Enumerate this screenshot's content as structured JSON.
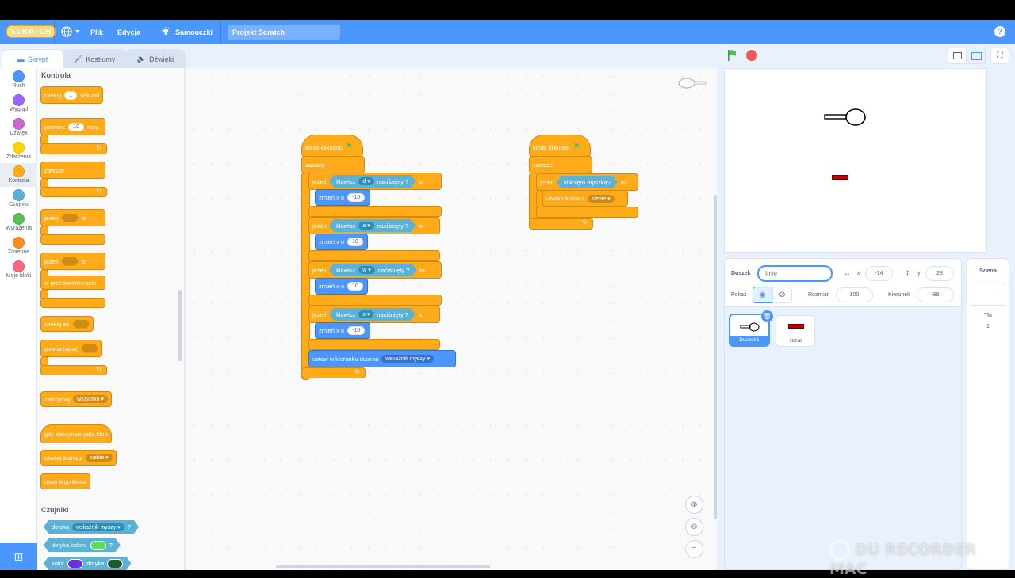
{
  "menu": {
    "logo": "SCRATCH",
    "file": "Plik",
    "edit": "Edycja",
    "tutorials": "Samouczki",
    "project_name": "Projekt Scratch",
    "help": "?"
  },
  "tabs": [
    {
      "label": "Skrypt",
      "active": true
    },
    {
      "label": "Kostiumy",
      "active": false
    },
    {
      "label": "Dźwięki",
      "active": false
    }
  ],
  "categories": [
    {
      "label": "Ruch",
      "color": "#4c97ff"
    },
    {
      "label": "Wygląd",
      "color": "#9966ff"
    },
    {
      "label": "Dźwięk",
      "color": "#cf63cf"
    },
    {
      "label": "Zdarzenia",
      "color": "#ffd500"
    },
    {
      "label": "Kontrola",
      "color": "#ffab19"
    },
    {
      "label": "Czujniki",
      "color": "#5cb1d6"
    },
    {
      "label": "Wyrażenia",
      "color": "#59c059"
    },
    {
      "label": "Zmienne",
      "color": "#ff8c1a"
    },
    {
      "label": "Moje bloki",
      "color": "#ff6680"
    }
  ],
  "palette": {
    "control_title": "Kontrola",
    "wait": {
      "a": "czekaj",
      "value": "1",
      "b": "sekund"
    },
    "repeat": {
      "a": "powtórz",
      "value": "10",
      "b": "razy"
    },
    "forever": "zawsze",
    "if_then": {
      "a": "jeżeli",
      "b": "to"
    },
    "if_else": {
      "a": "jeżeli",
      "b": "to",
      "else": "w przeciwnym razie"
    },
    "wait_until": "czekaj aż",
    "repeat_until": "powtarzaj aż",
    "stop": {
      "a": "zatrzymaj",
      "value": "wszystko"
    },
    "when_clone": "gdy zaczynam jako klon",
    "create_clone": {
      "a": "utwórz klona z",
      "value": "siebie"
    },
    "delete_clone": "usuń tego klona",
    "sensing_title": "Czujniki",
    "touching": {
      "a": "dotyka",
      "value": "wskaźnik myszy",
      "q": "?"
    },
    "touching_color": {
      "a": "dotyka koloru",
      "q": "?",
      "color": "#59e059"
    },
    "color_touching": {
      "a": "kolor",
      "b": "dotyka",
      "c1": "#6c2ee0",
      "c2": "#1e5a2a"
    }
  },
  "script1": {
    "hat": "kiedy kliknięto",
    "forever": "zawsze",
    "ifs": [
      {
        "if": "jeżeli",
        "key_a": "klawisz",
        "key": "d",
        "key_b": "naciśnięty ?",
        "then": "to",
        "change": "zmień x o",
        "value": "-10"
      },
      {
        "if": "jeżeli",
        "key_a": "klawisz",
        "key": "a",
        "key_b": "naciśnięty ?",
        "then": "to",
        "change": "zmień x o",
        "value": "10"
      },
      {
        "if": "jeżeli",
        "key_a": "klawisz",
        "key": "w",
        "key_b": "naciśnięty ?",
        "then": "to",
        "change": "zmień x o",
        "value": "10"
      },
      {
        "if": "jeżeli",
        "key_a": "klawisz",
        "key": "s",
        "key_b": "naciśnięty ?",
        "then": "to",
        "change": "zmień x o",
        "value": "-10"
      }
    ],
    "point": {
      "a": "ustaw w kierunku duszka",
      "value": "wskaźnik myszy"
    }
  },
  "script2": {
    "hat": "kiedy kliknięto",
    "forever": "zawsze",
    "if": "jeżeli",
    "cond": "kliknięto myszką?",
    "then": "to",
    "clone": {
      "a": "utwórz klona z",
      "value": "siebie"
    }
  },
  "sprite_info": {
    "sprite_label": "Duszek",
    "name_placeholder": "Imię",
    "x_label": "x",
    "x": "-14",
    "y_label": "y",
    "y": "28",
    "show_label": "Pokaż",
    "size_label": "Rozmiar",
    "size": "100",
    "direction_label": "Kierunek",
    "direction": "-89"
  },
  "sprites": [
    {
      "name": "Duszek1",
      "selected": true
    },
    {
      "name": "strzał",
      "selected": false
    }
  ],
  "stage_pane": {
    "title": "Scena",
    "backdrops_label": "Tła",
    "backdrops_count": "1"
  },
  "watermark": "DU RECORDER MAC"
}
